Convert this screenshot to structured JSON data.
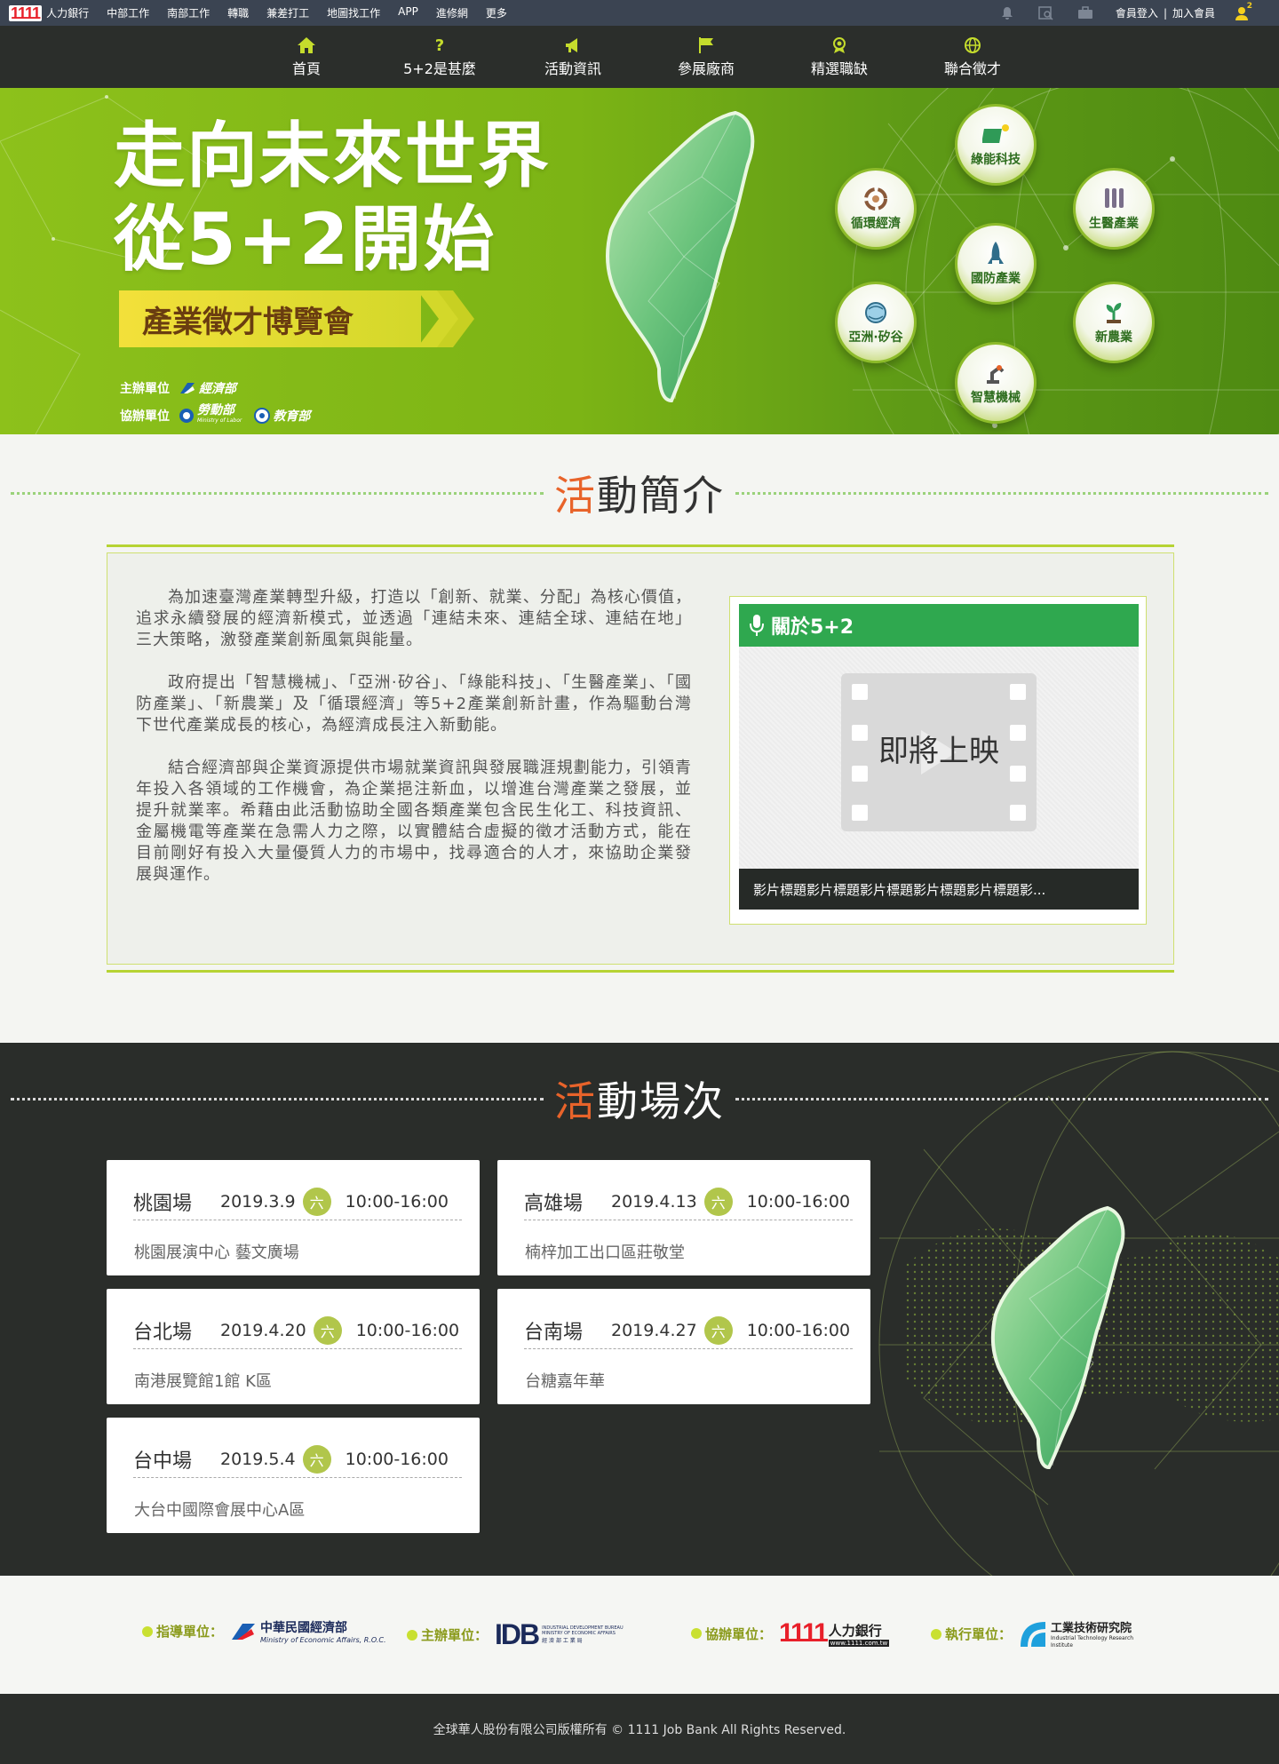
{
  "topbar": {
    "logo": "1111",
    "brand": "人力銀行",
    "links": [
      "中部工作",
      "南部工作",
      "轉職",
      "兼差打工",
      "地圖找工作",
      "APP",
      "進修網",
      "更多"
    ],
    "login": "會員登入",
    "signup": "加入會員",
    "badge": "2"
  },
  "nav": {
    "items": [
      {
        "label": "首頁",
        "icon": "home-icon"
      },
      {
        "label": "5+2是甚麼",
        "icon": "question-icon"
      },
      {
        "label": "活動資訊",
        "icon": "megaphone-icon"
      },
      {
        "label": "參展廠商",
        "icon": "flag-icon"
      },
      {
        "label": "精選職缺",
        "icon": "medal-icon"
      },
      {
        "label": "聯合徵才",
        "icon": "globe-icon"
      }
    ]
  },
  "banner": {
    "title_line1": "走向未來世界",
    "title_line2": "從5+2開始",
    "subtitle": "產業徵才博覽會",
    "host_label": "主辦單位",
    "host_org": "經濟部",
    "co_label": "協辦單位",
    "co_org1": "勞動部",
    "co_org1_en": "Ministry of Labor",
    "co_org2": "教育部",
    "industries": [
      "綠能科技",
      "循環經濟",
      "生醫產業",
      "國防產業",
      "亞洲·矽谷",
      "新農業",
      "智慧機械"
    ]
  },
  "intro": {
    "title_hl": "活",
    "title_rest": "動簡介",
    "paragraphs": [
      "為加速臺灣產業轉型升級，打造以「創新、就業、分配」為核心價值，追求永續發展的經濟新模式，並透過「連結未來、連結全球、連結在地」三大策略，激發產業創新風氣與能量。",
      "政府提出「智慧機械」、「亞洲·矽谷」、「綠能科技」、「生醫產業」、「國防產業」、「新農業」及「循環經濟」等5+2產業創新計畫，作為驅動台灣下世代產業成長的核心，為經濟成長注入新動能。",
      "結合經濟部與企業資源提供市場就業資訊與發展職涯規劃能力，引領青年投入各領域的工作機會，為企業挹注新血，以增進台灣產業之發展，並提升就業率。希藉由此活動協助全國各類產業包含民生化工、科技資訊、金屬機電等產業在急需人力之際，以實體結合虛擬的徵才活動方式，能在目前剛好有投入大量優質人力的市場中，找尋適合的人才，來協助企業發展與運作。"
    ],
    "video_header": "關於5+2",
    "video_placeholder": "即將上映",
    "video_caption": "影片標題影片標題影片標題影片標題影片標題影..."
  },
  "schedule": {
    "title_hl": "活",
    "title_rest": "動場次",
    "sessions": [
      {
        "city": "桃園場",
        "date": "2019.3.9",
        "day": "六",
        "time": "10:00-16:00",
        "venue": "桃園展演中心 藝文廣場"
      },
      {
        "city": "高雄場",
        "date": "2019.4.13",
        "day": "六",
        "time": "10:00-16:00",
        "venue": "楠梓加工出口區莊敬堂"
      },
      {
        "city": "台北場",
        "date": "2019.4.20",
        "day": "六",
        "time": "10:00-16:00",
        "venue": "南港展覽館1館 K區"
      },
      {
        "city": "台南場",
        "date": "2019.4.27",
        "day": "六",
        "time": "10:00-16:00",
        "venue": "台糖嘉年華"
      },
      {
        "city": "台中場",
        "date": "2019.5.4",
        "day": "六",
        "time": "10:00-16:00",
        "venue": "大台中國際會展中心A區"
      }
    ]
  },
  "sponsors": {
    "items": [
      {
        "label": "指導單位：",
        "name": "中華民國經濟部",
        "sub": "Ministry of Economic Affairs, R.O.C."
      },
      {
        "label": "主辦單位：",
        "name": "IDB",
        "sub": "INDUSTRIAL DEVELOPMENT BUREAU MINISTRY OF ECONOMIC AFFAIRS",
        "sub2": "經 濟 部 工 業 局"
      },
      {
        "label": "協辦單位：",
        "name": "1111",
        "name2": "人力銀行",
        "sub": "www.1111.com.tw"
      },
      {
        "label": "執行單位：",
        "name": "工業技術研究院",
        "sub": "Industrial Technology Research Institute"
      }
    ]
  },
  "footer": {
    "copyright": "全球華人股份有限公司版權所有 © 1111 Job Bank All Rights Reserved."
  },
  "colors": {
    "accent_green": "#2fa84f",
    "lime": "#b6d334",
    "highlight_orange": "#e8632a",
    "dark": "#2a2d2a"
  }
}
